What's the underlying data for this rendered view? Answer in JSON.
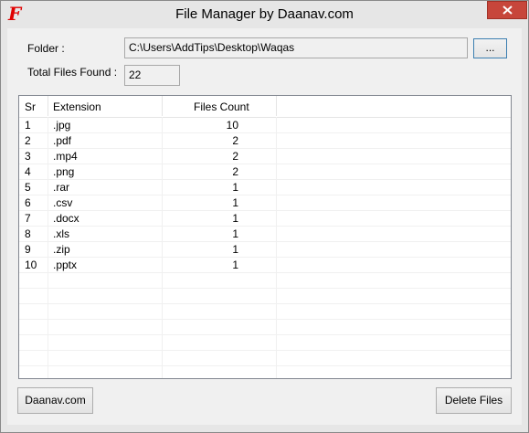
{
  "window": {
    "title": "File Manager by Daanav.com",
    "icon": "app-f-logo-icon"
  },
  "folder": {
    "label": "Folder :",
    "value": "C:\\Users\\AddTips\\Desktop\\Waqas",
    "browse_label": "..."
  },
  "total": {
    "label": "Total Files Found :",
    "value": "22"
  },
  "table": {
    "columns": [
      "Sr",
      "Extension",
      "Files Count"
    ],
    "rows": [
      {
        "sr": "1",
        "ext": ".jpg",
        "count": "10"
      },
      {
        "sr": "2",
        "ext": ".pdf",
        "count": "2"
      },
      {
        "sr": "3",
        "ext": ".mp4",
        "count": "2"
      },
      {
        "sr": "4",
        "ext": ".png",
        "count": "2"
      },
      {
        "sr": "5",
        "ext": ".rar",
        "count": "1"
      },
      {
        "sr": "6",
        "ext": ".csv",
        "count": "1"
      },
      {
        "sr": "7",
        "ext": ".docx",
        "count": "1"
      },
      {
        "sr": "8",
        "ext": ".xls",
        "count": "1"
      },
      {
        "sr": "9",
        "ext": ".zip",
        "count": "1"
      },
      {
        "sr": "10",
        "ext": ".pptx",
        "count": "1"
      }
    ]
  },
  "buttons": {
    "website": "Daanav.com",
    "delete": "Delete Files"
  },
  "colors": {
    "close_button": "#c7463b",
    "icon": "#e00000",
    "accent_border": "#3c7fb1"
  }
}
